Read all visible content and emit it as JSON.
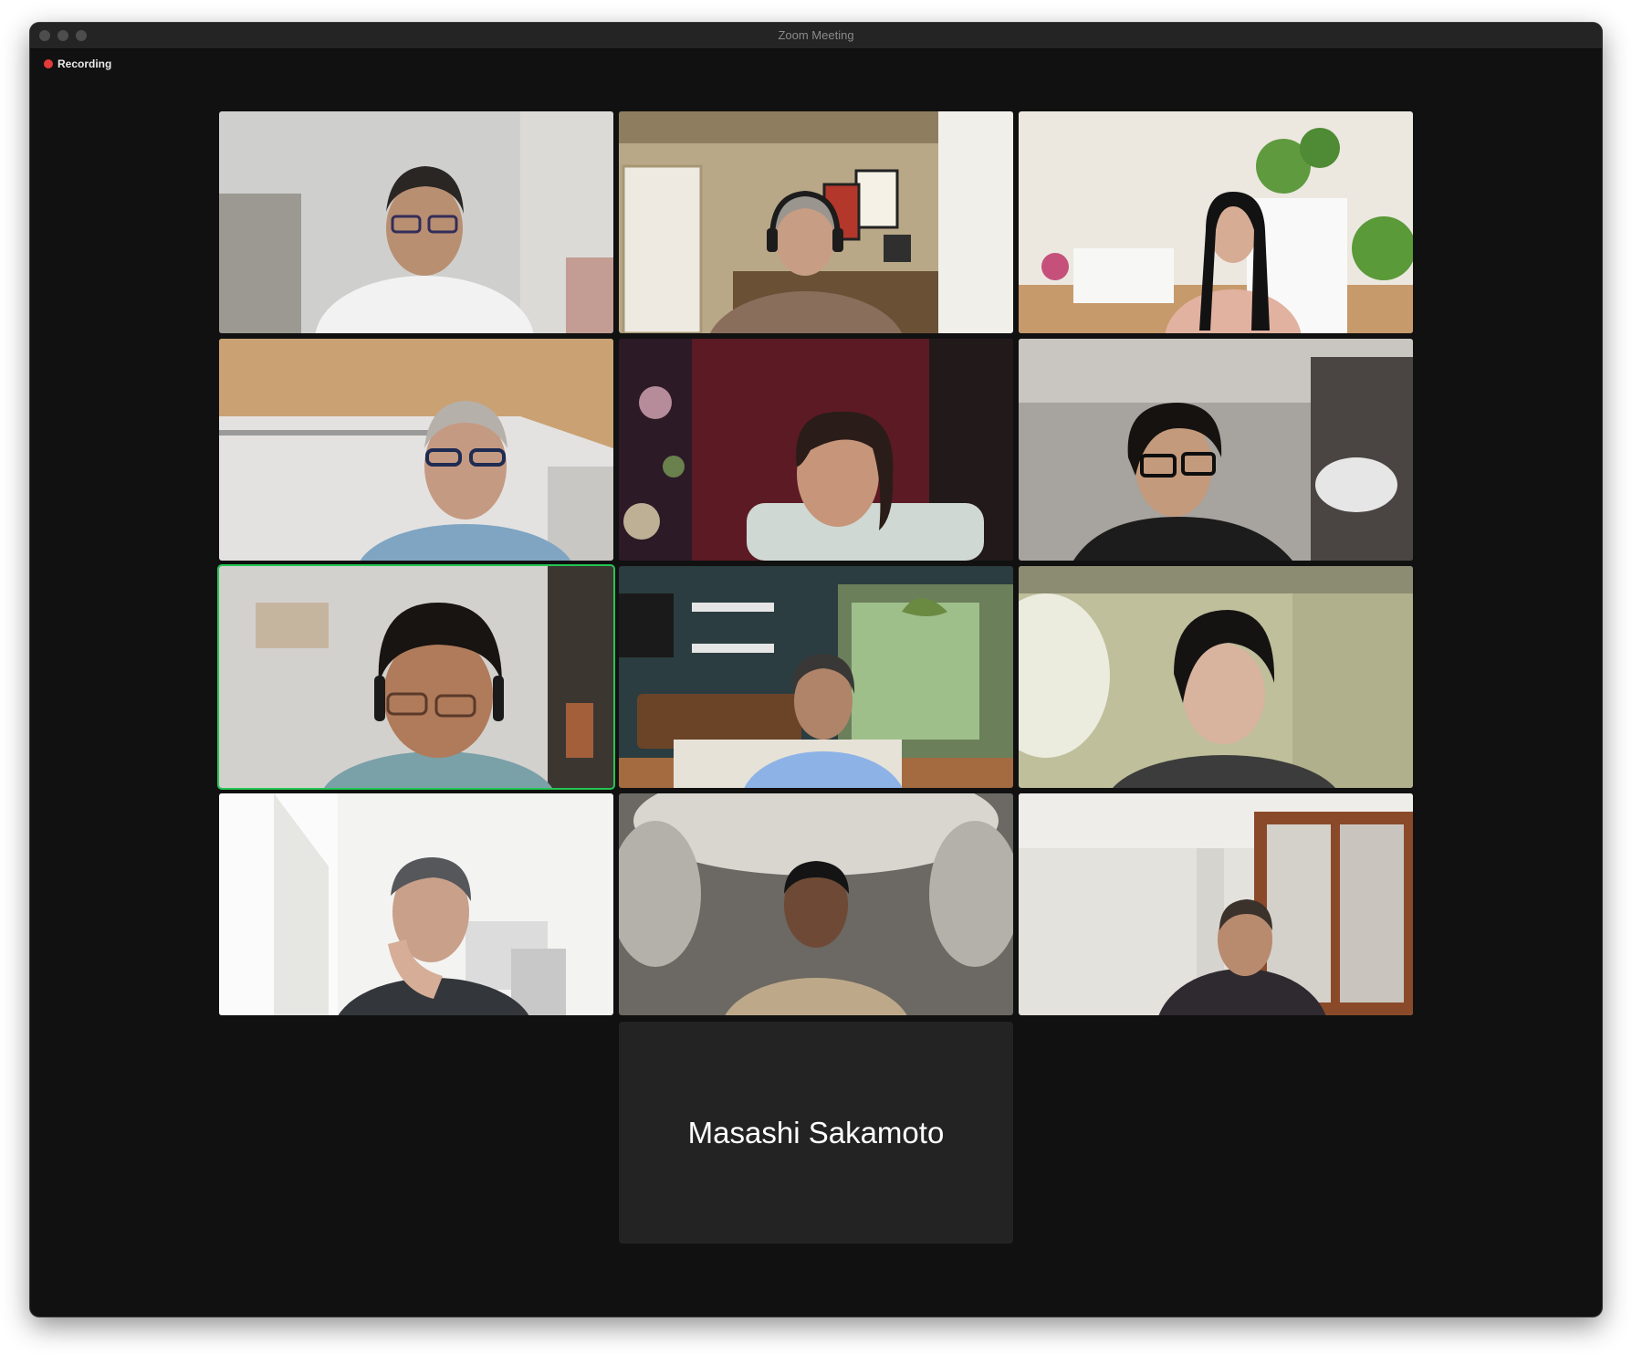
{
  "window": {
    "title": "Zoom Meeting"
  },
  "recording": {
    "label": "Recording",
    "indicator_color": "#e43b3b"
  },
  "active_speaker_color": "#23c552",
  "participants": [
    {
      "tile": "video",
      "active": false
    },
    {
      "tile": "video",
      "active": false
    },
    {
      "tile": "video",
      "active": false
    },
    {
      "tile": "video",
      "active": false
    },
    {
      "tile": "video",
      "active": false
    },
    {
      "tile": "video",
      "active": false
    },
    {
      "tile": "video",
      "active": true
    },
    {
      "tile": "video",
      "active": false
    },
    {
      "tile": "video",
      "active": false
    },
    {
      "tile": "video",
      "active": false
    },
    {
      "tile": "video",
      "active": false
    },
    {
      "tile": "video",
      "active": false
    },
    {
      "tile": "name",
      "name": "Masashi Sakamoto",
      "active": false
    }
  ]
}
